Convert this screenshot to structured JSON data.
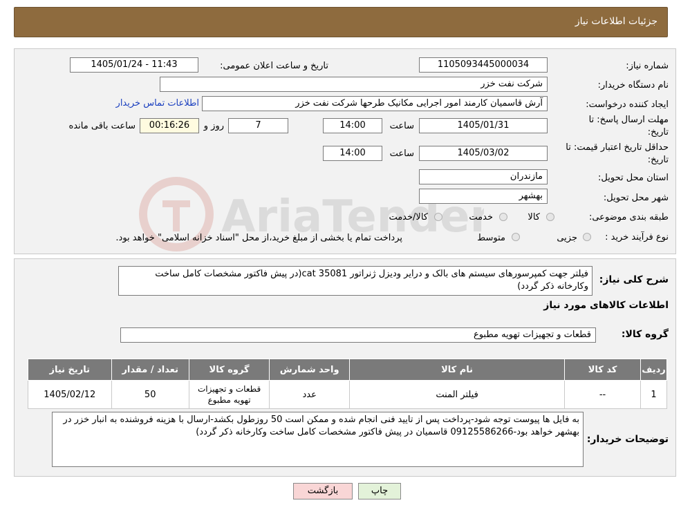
{
  "header": {
    "title": "جزئیات اطلاعات نیاز"
  },
  "form": {
    "need_number_label": "شماره نیاز:",
    "need_number": "1105093445000034",
    "announce_label": "تاریخ و ساعت اعلان عمومی:",
    "announce_value": "1405/01/24 - 11:43",
    "buyer_org_label": "نام دستگاه خریدار:",
    "buyer_org": "شرکت نفت خزر",
    "creator_label": "ایجاد کننده درخواست:",
    "creator": "آرش قاسمیان کارمند امور اجرایی مکانیک طرحها شرکت نفت خزر",
    "contact_link": "اطلاعات تماس خریدار",
    "reply_deadline_label_1": "مهلت ارسال پاسخ: تا",
    "reply_deadline_label_2": "تاریخ:",
    "reply_date": "1405/01/31",
    "time_label": "ساعت",
    "reply_time": "14:00",
    "days": "7",
    "days_label": "روز و",
    "remaining": "00:16:26",
    "remaining_label": "ساعت باقی مانده",
    "price_validity_label_1": "حداقل تاریخ اعتبار قیمت: تا",
    "price_validity_label_2": "تاریخ:",
    "price_date": "1405/03/02",
    "price_time": "14:00",
    "province_label": "استان محل تحویل:",
    "province": "مازندران",
    "city_label": "شهر محل تحویل:",
    "city": "بهشهر",
    "category_label": "طبقه بندی موضوعی:",
    "category_options": [
      "کالا",
      "خدمت",
      "کالا/خدمت"
    ],
    "process_label": "نوع فرآیند خرید :",
    "process_options": [
      "جزیی",
      "متوسط"
    ],
    "process_note": "پرداخت تمام یا بخشی از مبلغ خرید،از محل \"اسناد خزانه اسلامی\" خواهد بود."
  },
  "description": {
    "label": "شرح کلی نیاز:",
    "text": "فیلتر جهت کمپرسورهای سیستم های بالک و درایر ودیزل ژنراتور cat 35081(در پیش فاکتور مشخصات کامل ساخت وکارخانه ذکر گردد)"
  },
  "goods": {
    "section_title": "اطلاعات کالاهای مورد نیاز",
    "group_label": "گروه کالا:",
    "group_value": "قطعات و تجهیزات تهویه مطبوع",
    "columns": [
      "ردیف",
      "کد کالا",
      "نام کالا",
      "واحد شمارش",
      "گروه کالا",
      "تعداد / مقدار",
      "تاریخ نیاز"
    ],
    "rows": [
      {
        "row": "1",
        "code": "--",
        "name": "فیلتر المنت",
        "unit": "عدد",
        "group": "قطعات و تجهیزات تهویه مطبوع",
        "qty": "50",
        "date": "1405/02/12"
      }
    ]
  },
  "buyer_notes": {
    "label": "توضیحات خریدار:",
    "text": "به فایل ها پیوست توجه شود-پرداخت پس از تایید فنی انجام شده و ممکن است 50 روزطول بکشد-ارسال با هزینه فروشنده به انبار خزر در بهشهر خواهد بود-09125586266 قاسمیان در پیش فاکتور مشخصات کامل ساخت وکارخانه ذکر گردد)"
  },
  "buttons": {
    "print": "چاپ",
    "back": "بازگشت"
  },
  "colors": {
    "header_bg": "#8e6b3e",
    "table_header": "#7a7a7a",
    "back_button": "#f9d6d6",
    "print_button": "#e3f2d9"
  }
}
